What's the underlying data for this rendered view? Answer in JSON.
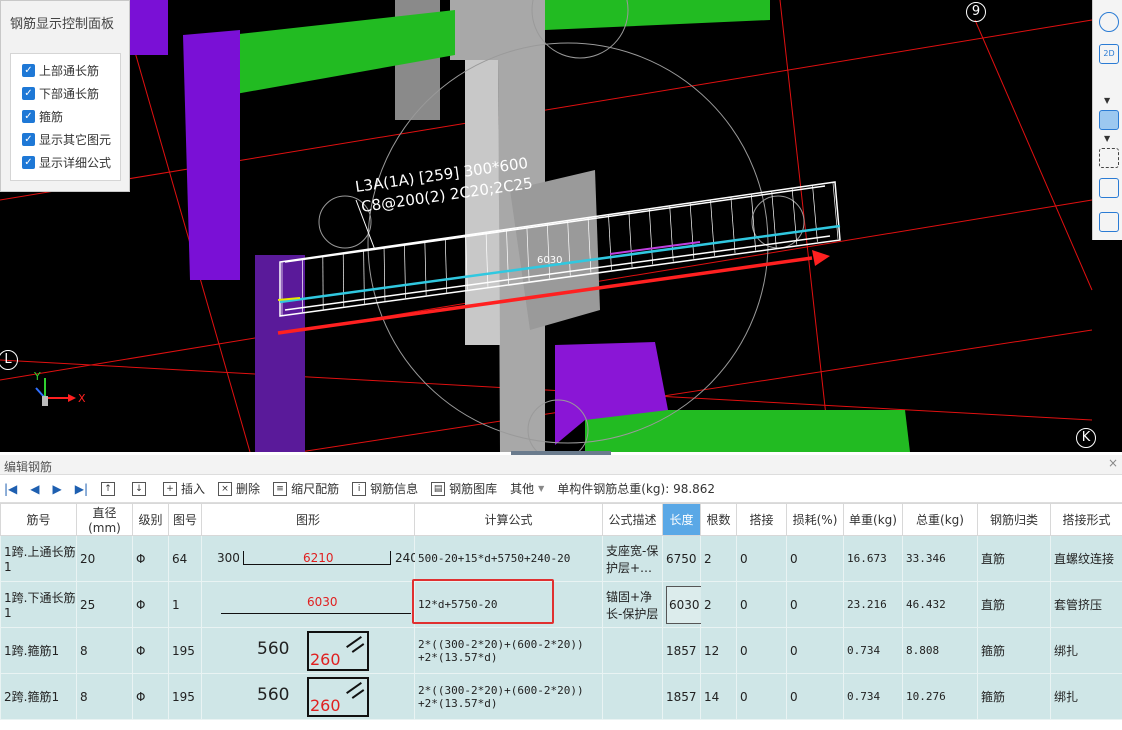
{
  "control_panel": {
    "title": "钢筋显示控制面板",
    "options": [
      {
        "label": "上部通长筋",
        "checked": true
      },
      {
        "label": "下部通长筋",
        "checked": true
      },
      {
        "label": "箍筋",
        "checked": true
      },
      {
        "label": "显示其它图元",
        "checked": true
      },
      {
        "label": "显示详细公式",
        "checked": true
      }
    ]
  },
  "viewport": {
    "beam_label_line1": "L3A(1A) [259] 300*600",
    "beam_label_line2": "C8@200(2) 2C20;2C25",
    "dimension": "6030",
    "axis_labels": {
      "top": "9",
      "left": "L",
      "bottom_right": "K"
    },
    "coord": {
      "x": "X",
      "y": "Y"
    }
  },
  "right_toolbar": {
    "icons": [
      "sphere-icon",
      "2d-view-icon",
      "3d-box-icon",
      "fit-view-icon",
      "cube-select-icon",
      "list-settings-icon"
    ],
    "label_2d": "2D"
  },
  "editor": {
    "title": "编辑钢筋",
    "close": "×",
    "toolbar": {
      "insert": "插入",
      "delete": "删除",
      "scale": "缩尺配筋",
      "info": "钢筋信息",
      "library": "钢筋图库",
      "other": "其他",
      "weight_label": "单构件钢筋总重(kg): 98.862"
    },
    "columns": [
      "筋号",
      "直径(mm)",
      "级别",
      "图号",
      "图形",
      "计算公式",
      "公式描述",
      "长度",
      "根数",
      "搭接",
      "损耗(%)",
      "单重(kg)",
      "总重(kg)",
      "钢筋归类",
      "搭接形式"
    ],
    "rows": [
      {
        "index": "1",
        "name": "1跨.上通长筋1",
        "dia": "20",
        "grade": "Φ",
        "fig": "64",
        "shape_left": "300",
        "shape_mid": "6210",
        "shape_right": "240",
        "formula": "500-20+15*d+5750+240-20",
        "desc": "支座宽-保护层+…",
        "length": "6750",
        "count": "2",
        "lap": "0",
        "loss": "0",
        "unit_w": "16.673",
        "total_w": "33.346",
        "category": "直筋",
        "lap_type": "直螺纹连接"
      },
      {
        "index": "2",
        "name": "1跨.下通长筋1",
        "dia": "25",
        "grade": "Φ",
        "fig": "1",
        "shape_mid": "6030",
        "formula": "12*d+5750-20",
        "desc": "锚固+净长-保护层",
        "length": "6030",
        "count": "2",
        "lap": "0",
        "loss": "0",
        "unit_w": "23.216",
        "total_w": "46.432",
        "category": "直筋",
        "lap_type": "套管挤压"
      },
      {
        "index": "3",
        "name": "1跨.箍筋1",
        "dia": "8",
        "grade": "Φ",
        "fig": "195",
        "shape_left": "560",
        "shape_mid": "260",
        "formula_l1": "2*((300-2*20)+(600-2*20))",
        "formula_l2": "+2*(13.57*d)",
        "length": "1857",
        "count": "12",
        "lap": "0",
        "loss": "0",
        "unit_w": "0.734",
        "total_w": "8.808",
        "category": "箍筋",
        "lap_type": "绑扎"
      },
      {
        "index": "4",
        "name": "2跨.箍筋1",
        "dia": "8",
        "grade": "Φ",
        "fig": "195",
        "shape_left": "560",
        "shape_mid": "260",
        "formula_l1": "2*((300-2*20)+(600-2*20))",
        "formula_l2": "+2*(13.57*d)",
        "length": "1857",
        "count": "14",
        "lap": "0",
        "loss": "0",
        "unit_w": "0.734",
        "total_w": "10.276",
        "category": "箍筋",
        "lap_type": "绑扎"
      }
    ]
  }
}
